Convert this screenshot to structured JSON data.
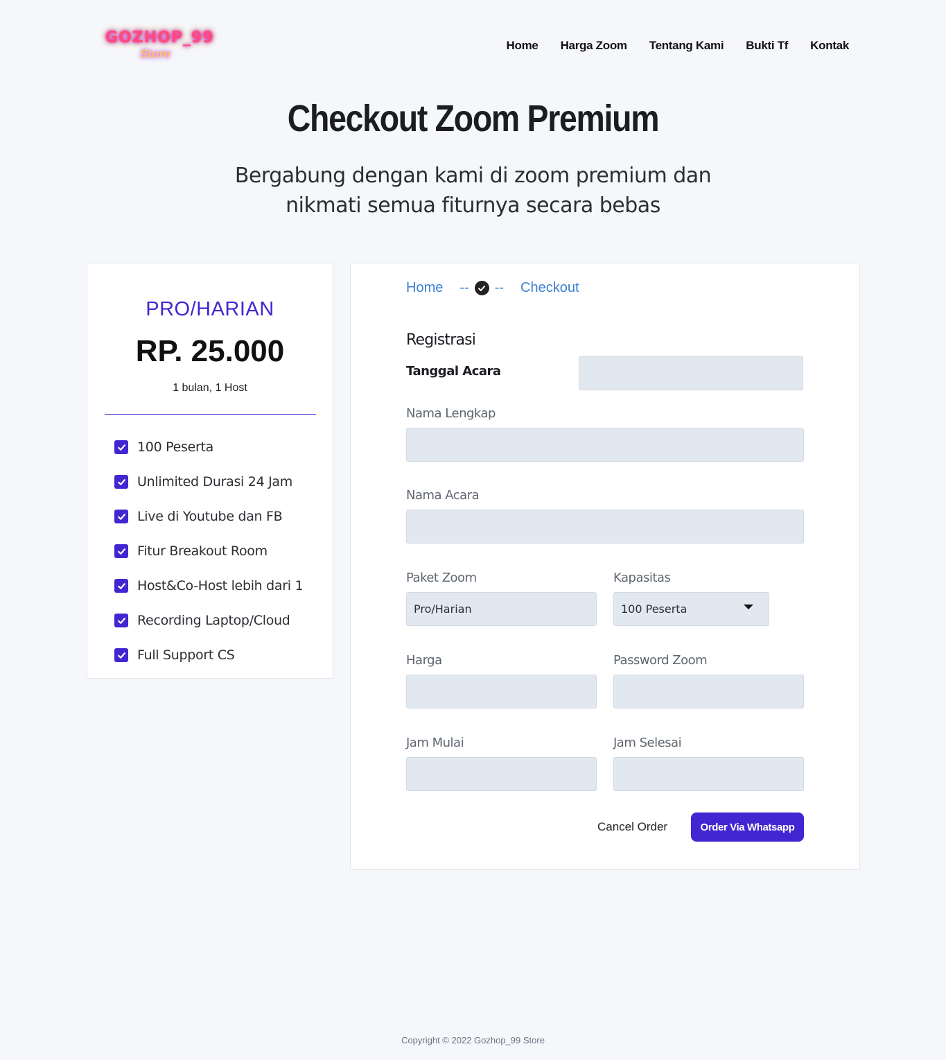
{
  "brand": {
    "logo_text": "GOZHOP_99",
    "logo_sub": "Store"
  },
  "nav": [
    "Home",
    "Harga Zoom",
    "Tentang Kami",
    "Bukti Tf",
    "Kontak"
  ],
  "hero": {
    "title": "Checkout Zoom Premium",
    "subtitle": "Bergabung dengan kami di zoom premium dan nikmati semua fiturnya secara bebas"
  },
  "plan": {
    "name": "PRO/HARIAN",
    "price": "RP. 25.000",
    "period": "1 bulan, 1 Host",
    "features": [
      "100 Peserta",
      "Unlimited Durasi 24 Jam",
      "Live di Youtube dan FB",
      "Fitur Breakout Room",
      "Host&Co-Host lebih dari 1",
      "Recording Laptop/Cloud",
      "Full Support CS"
    ]
  },
  "breadcrumb": {
    "home": "Home",
    "sep": "--",
    "current": "Checkout"
  },
  "form": {
    "section_title": "Registrasi",
    "tanggal_label": "Tanggal Acara",
    "nama_lengkap_label": "Nama Lengkap",
    "nama_acara_label": "Nama Acara",
    "paket_label": "Paket Zoom",
    "paket_value": "Pro/Harian",
    "kapasitas_label": "Kapasitas",
    "kapasitas_value": "100 Peserta",
    "harga_label": "Harga",
    "password_label": "Password Zoom",
    "jam_mulai_label": "Jam Mulai",
    "jam_selesai_label": "Jam Selesai",
    "cancel_label": "Cancel Order",
    "order_label": "Order Via Whatsapp"
  },
  "footer": "Copyright © 2022 Gozhop_99 Store",
  "colors": {
    "accent": "#4226d1",
    "link": "#3b7fd0",
    "field_bg": "#e2e8f0",
    "page_bg": "#f6f7fb"
  }
}
